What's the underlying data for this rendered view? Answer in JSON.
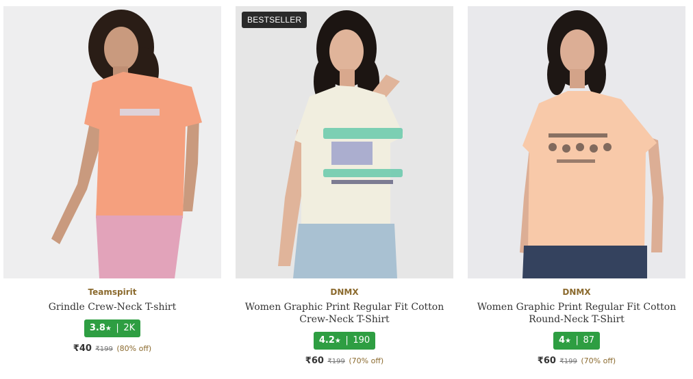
{
  "products": [
    {
      "badge": "",
      "brand": "Teamspirit",
      "title": "Grindle Crew-Neck T-shirt",
      "rating": "3.8",
      "star": "★",
      "rating_sep": "|",
      "review_count": "2K",
      "price": "₹40",
      "mrp": "₹199",
      "discount": "(80% off)",
      "colors": {
        "bg": "#eeeeef",
        "shirt": "#f5a07e",
        "bottom": "#e2a3ba"
      }
    },
    {
      "badge": "BESTSELLER",
      "brand": "DNMX",
      "title": "Women Graphic Print Regular Fit Cotton Crew-Neck T-Shirt",
      "rating": "4.2",
      "star": "★",
      "rating_sep": "|",
      "review_count": "190",
      "price": "₹60",
      "mrp": "₹199",
      "discount": "(70% off)",
      "colors": {
        "bg": "#e6e6e6",
        "shirt": "#f1eedf",
        "bottom": "#a9c1d2"
      }
    },
    {
      "badge": "",
      "brand": "DNMX",
      "title": "Women Graphic Print Regular Fit Cotton Round-Neck T-Shirt",
      "rating": "4",
      "star": "★",
      "rating_sep": "|",
      "review_count": "87",
      "price": "₹60",
      "mrp": "₹199",
      "discount": "(70% off)",
      "colors": {
        "bg": "#e9e9ec",
        "shirt": "#f8c9a9",
        "bottom": "#34425e"
      }
    }
  ]
}
